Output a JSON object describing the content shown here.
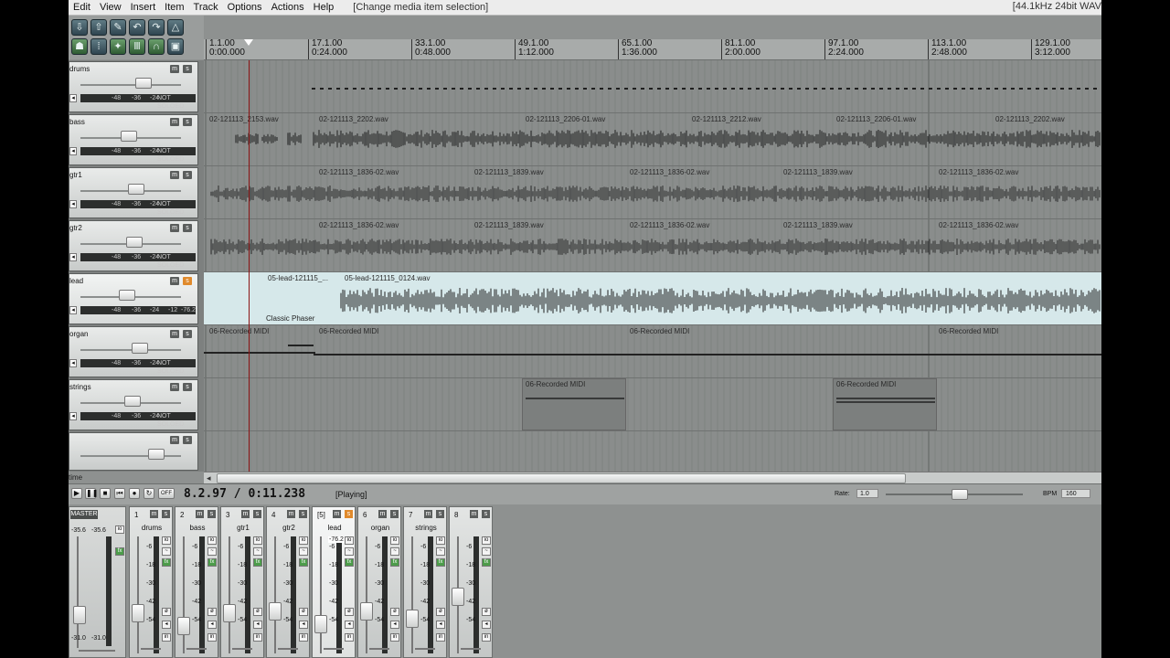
{
  "menu": [
    "Edit",
    "View",
    "Insert",
    "Item",
    "Track",
    "Options",
    "Actions",
    "Help"
  ],
  "selection_status": "[Change media item selection]",
  "format_status": "[44.1kHz 24bit WAV",
  "ruler": [
    {
      "bar": "1.1.00",
      "time": "0:00.000"
    },
    {
      "bar": "17.1.00",
      "time": "0:24.000"
    },
    {
      "bar": "33.1.00",
      "time": "0:48.000"
    },
    {
      "bar": "49.1.00",
      "time": "1:12.000"
    },
    {
      "bar": "65.1.00",
      "time": "1:36.000"
    },
    {
      "bar": "81.1.00",
      "time": "2:00.000"
    },
    {
      "bar": "97.1.00",
      "time": "2:24.000"
    },
    {
      "bar": "113.1.00",
      "time": "2:48.000"
    },
    {
      "bar": "129.1.00",
      "time": "3:12.000"
    }
  ],
  "tracks": [
    {
      "name": "drums",
      "mute": "m",
      "solo": "s",
      "meter": [
        "-48",
        "-36",
        "-24",
        "NOT SOLOED"
      ],
      "items": []
    },
    {
      "name": "bass",
      "mute": "m",
      "solo": "s",
      "meter": [
        "-48",
        "-36",
        "-24",
        "NOT SOLOED"
      ],
      "items": [
        "02-121113_2153.wav",
        "02-121113_2202.wav",
        "02-121113_2206-01.wav",
        "02-121113_2212.wav",
        "02-121113_2206-01.wav",
        "02-121113_2202.wav"
      ]
    },
    {
      "name": "gtr1",
      "mute": "m",
      "solo": "s",
      "meter": [
        "-48",
        "-36",
        "-24",
        "NOT SOLOED"
      ],
      "items": [
        "02-121113_1836-02.wav",
        "02-121113_1839.wav",
        "02-121113_1836-02.wav",
        "02-121113_1839.wav",
        "02-121113_1836-02.wav"
      ]
    },
    {
      "name": "gtr2",
      "mute": "m",
      "solo": "s",
      "meter": [
        "-48",
        "-36",
        "-24",
        "NOT SOLOED"
      ],
      "items": [
        "02-121113_1836-02.wav",
        "02-121113_1839.wav",
        "02-121113_1836-02.wav",
        "02-121113_1839.wav",
        "02-121113_1836-02.wav"
      ]
    },
    {
      "name": "lead",
      "mute": "m",
      "solo": "s",
      "meter": [
        "-48",
        "-36",
        "-24",
        "-12",
        "-76.2"
      ],
      "items": [
        "05-lead-121115_...",
        "05-lead-121115_0124.wav"
      ],
      "fx": "Classic Phaser"
    },
    {
      "name": "organ",
      "mute": "m",
      "solo": "s",
      "meter": [
        "-48",
        "-36",
        "-24",
        "NOT SOLOED"
      ],
      "items": [
        "06-Recorded MIDI",
        "06-Recorded MIDI",
        "06-Recorded MIDI",
        "06-Recorded MIDI"
      ]
    },
    {
      "name": "strings",
      "mute": "m",
      "solo": "s",
      "meter": [
        "-48",
        "-36",
        "-24",
        "NOT SOLOED"
      ],
      "items": [
        "06-Recorded MIDI",
        "06-Recorded MIDI"
      ]
    },
    {
      "name": "",
      "mute": "m",
      "solo": "s",
      "meter": [],
      "items": []
    }
  ],
  "time_label": "time",
  "transport": {
    "time": "8.2.97 / 0:11.238",
    "state": "[Playing]",
    "off": "OFF",
    "rate_label": "Rate:",
    "rate": "1.0",
    "bpm_label": "BPM",
    "bpm": "160"
  },
  "mixer": {
    "master_label": "MASTER",
    "master_peaks": [
      "-35.6",
      "-35.6"
    ],
    "master_bottom": [
      "-31.0",
      "-31.0"
    ],
    "scale": [
      "-6",
      "-18",
      "-30",
      "-42",
      "-54"
    ],
    "strips": [
      {
        "num": "1",
        "name": "drums"
      },
      {
        "num": "2",
        "name": "bass"
      },
      {
        "num": "3",
        "name": "gtr1"
      },
      {
        "num": "4",
        "name": "gtr2"
      },
      {
        "num": "[5]",
        "name": "lead",
        "peak": "-76.2"
      },
      {
        "num": "6",
        "name": "organ"
      },
      {
        "num": "7",
        "name": "strings"
      },
      {
        "num": "8",
        "name": ""
      }
    ]
  },
  "colors": {
    "solo_active": "#e08a2c",
    "playhead": "#8b1414",
    "lead_lane": "#d6e8ea"
  }
}
